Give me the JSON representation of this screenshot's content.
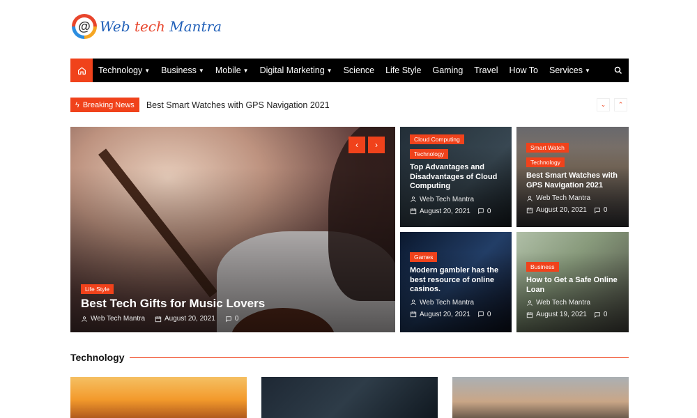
{
  "logo": {
    "mark": "@",
    "word1": "Web",
    "word2": "tech",
    "word3": "Mantra"
  },
  "nav": {
    "home_icon": "home-icon",
    "items": [
      {
        "label": "Technology",
        "dropdown": true
      },
      {
        "label": "Business",
        "dropdown": true
      },
      {
        "label": "Mobile",
        "dropdown": true
      },
      {
        "label": "Digital Marketing",
        "dropdown": true
      },
      {
        "label": "Science",
        "dropdown": false
      },
      {
        "label": "Life Style",
        "dropdown": false
      },
      {
        "label": "Gaming",
        "dropdown": false
      },
      {
        "label": "Travel",
        "dropdown": false
      },
      {
        "label": "How To",
        "dropdown": false
      },
      {
        "label": "Services",
        "dropdown": true
      }
    ],
    "search_icon": "search-icon"
  },
  "breaking": {
    "label": "Breaking News",
    "headline": "Best Smart Watches with GPS Navigation 2021"
  },
  "hero": {
    "tag": "Life Style",
    "title": "Best Tech Gifts for Music Lovers",
    "author": "Web Tech Mantra",
    "date": "August 20, 2021",
    "comments": "0"
  },
  "cards": [
    {
      "tags": [
        "Cloud Computing",
        "Technology"
      ],
      "title": "Top Advantages and Disadvantages of Cloud Computing",
      "author": "Web Tech Mantra",
      "date": "August 20, 2021",
      "comments": "0"
    },
    {
      "tags": [
        "Smart Watch",
        "Technology"
      ],
      "title": "Best Smart Watches with GPS Navigation 2021",
      "author": "Web Tech Mantra",
      "date": "August 20, 2021",
      "comments": "0"
    },
    {
      "tags": [
        "Games"
      ],
      "title": "Modern gambler has the best resource of online casinos.",
      "author": "Web Tech Mantra",
      "date": "August 20, 2021",
      "comments": "0"
    },
    {
      "tags": [
        "Business"
      ],
      "title": "How to Get a Safe Online Loan",
      "author": "Web Tech Mantra",
      "date": "August 19, 2021",
      "comments": "0"
    }
  ],
  "section": {
    "title": "Technology"
  },
  "colors": {
    "accent": "#f0421b",
    "nav_bg": "#000000"
  }
}
